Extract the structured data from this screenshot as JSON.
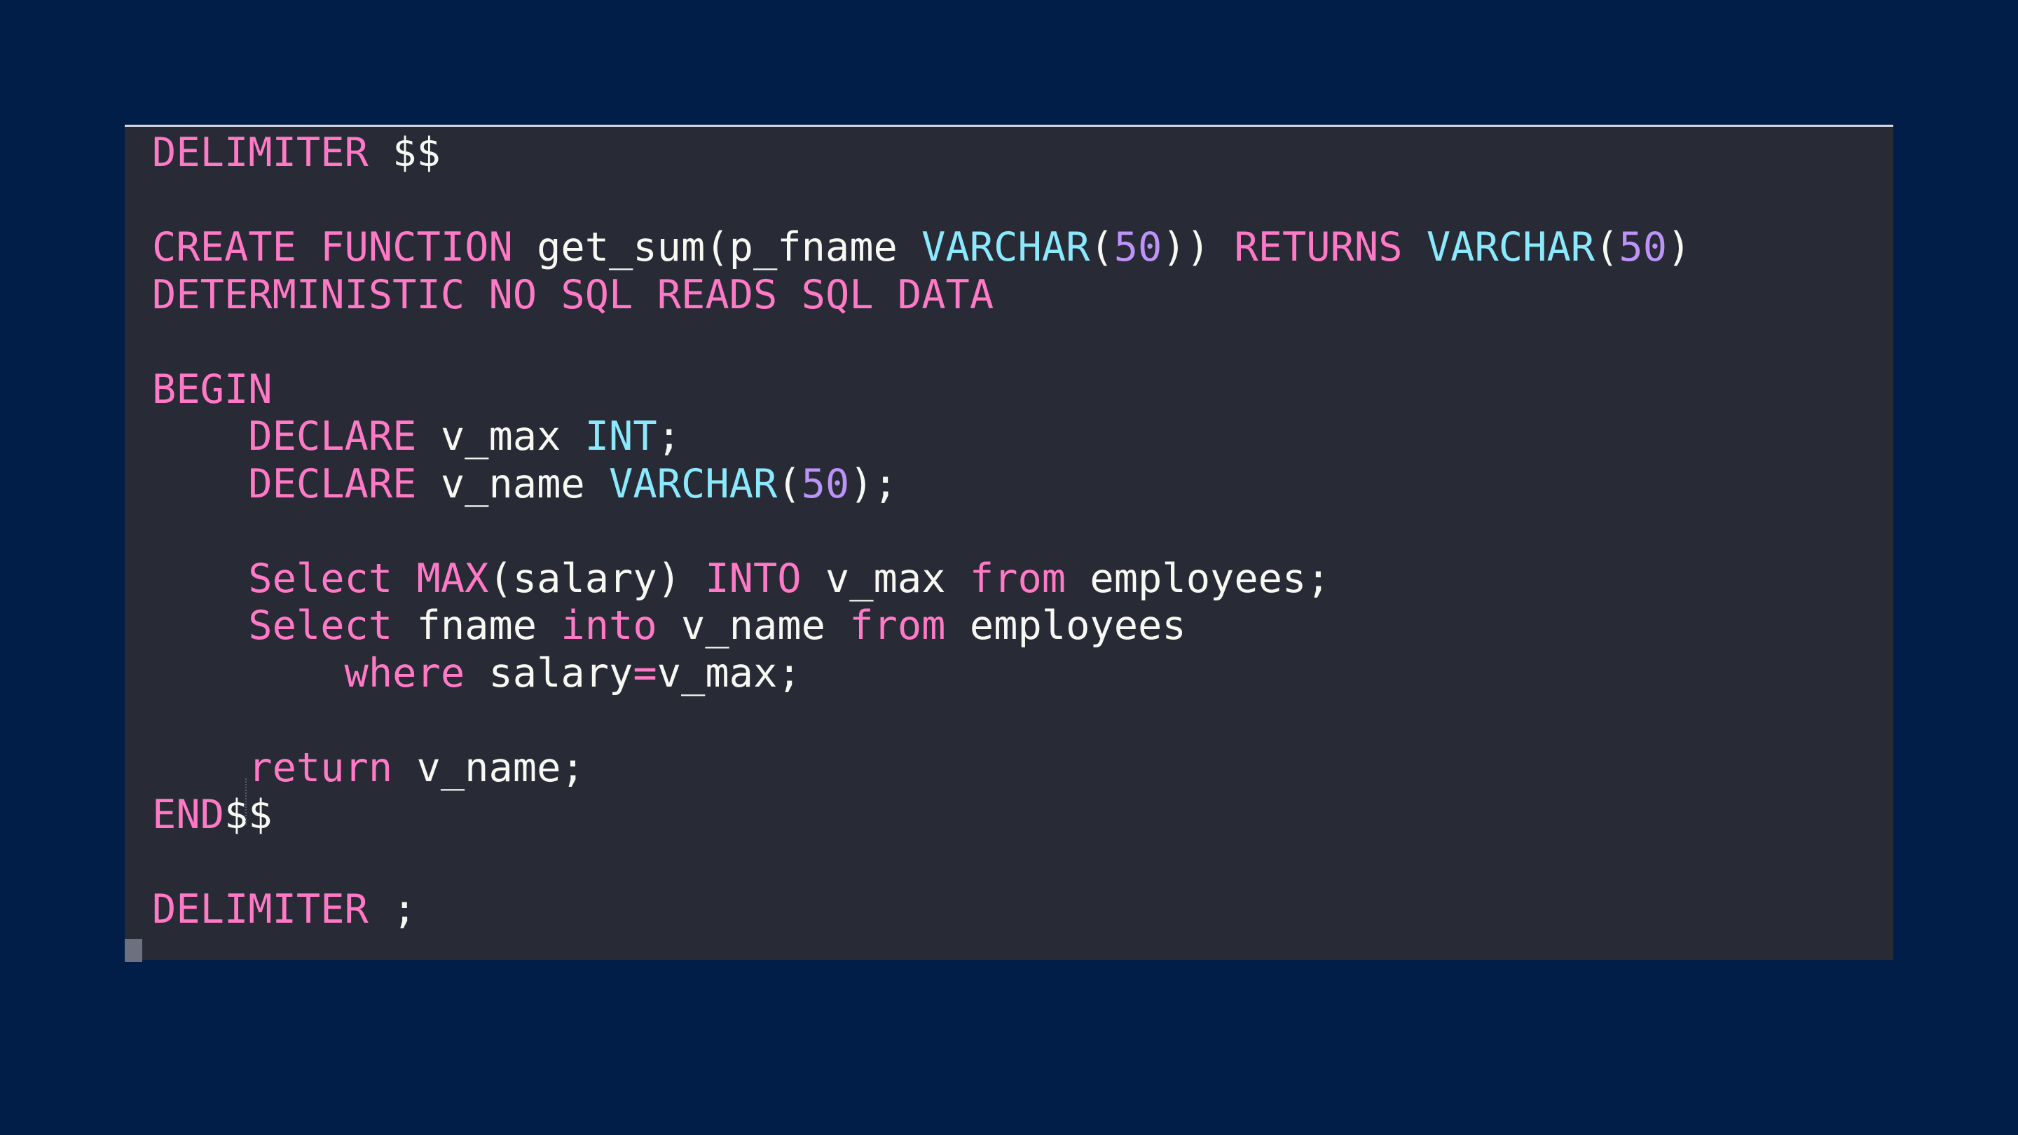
{
  "code_lines": [
    [
      {
        "t": "DELIMITER",
        "c": "kw"
      },
      {
        "t": " $$",
        "c": "tx"
      }
    ],
    [],
    [
      {
        "t": "CREATE",
        "c": "kw"
      },
      {
        "t": " ",
        "c": "tx"
      },
      {
        "t": "FUNCTION",
        "c": "kw"
      },
      {
        "t": " get_sum(p_fname ",
        "c": "tx"
      },
      {
        "t": "VARCHAR",
        "c": "ty"
      },
      {
        "t": "(",
        "c": "tx"
      },
      {
        "t": "50",
        "c": "nm"
      },
      {
        "t": ")) ",
        "c": "tx"
      },
      {
        "t": "RETURNS",
        "c": "kw"
      },
      {
        "t": " ",
        "c": "tx"
      },
      {
        "t": "VARCHAR",
        "c": "ty"
      },
      {
        "t": "(",
        "c": "tx"
      },
      {
        "t": "50",
        "c": "nm"
      },
      {
        "t": ")",
        "c": "tx"
      }
    ],
    [
      {
        "t": "DETERMINISTIC",
        "c": "kw"
      },
      {
        "t": " ",
        "c": "tx"
      },
      {
        "t": "NO",
        "c": "kw"
      },
      {
        "t": " ",
        "c": "tx"
      },
      {
        "t": "SQL",
        "c": "kw"
      },
      {
        "t": " ",
        "c": "tx"
      },
      {
        "t": "READS",
        "c": "kw"
      },
      {
        "t": " ",
        "c": "tx"
      },
      {
        "t": "SQL",
        "c": "kw"
      },
      {
        "t": " ",
        "c": "tx"
      },
      {
        "t": "DATA",
        "c": "kw"
      }
    ],
    [],
    [
      {
        "t": "BEGIN",
        "c": "kw"
      }
    ],
    [
      {
        "t": "    ",
        "c": "tx"
      },
      {
        "t": "DECLARE",
        "c": "kw"
      },
      {
        "t": " v_max ",
        "c": "tx"
      },
      {
        "t": "INT",
        "c": "ty"
      },
      {
        "t": ";",
        "c": "tx"
      }
    ],
    [
      {
        "t": "    ",
        "c": "tx"
      },
      {
        "t": "DECLARE",
        "c": "kw"
      },
      {
        "t": " v_name ",
        "c": "tx"
      },
      {
        "t": "VARCHAR",
        "c": "ty"
      },
      {
        "t": "(",
        "c": "tx"
      },
      {
        "t": "50",
        "c": "nm"
      },
      {
        "t": ");",
        "c": "tx"
      }
    ],
    [],
    [
      {
        "t": "    ",
        "c": "tx"
      },
      {
        "t": "Select",
        "c": "kw"
      },
      {
        "t": " ",
        "c": "tx"
      },
      {
        "t": "MAX",
        "c": "kw"
      },
      {
        "t": "(salary) ",
        "c": "tx"
      },
      {
        "t": "INTO",
        "c": "kw"
      },
      {
        "t": " v_max ",
        "c": "tx"
      },
      {
        "t": "from",
        "c": "kw"
      },
      {
        "t": " employees;",
        "c": "tx"
      }
    ],
    [
      {
        "t": "    ",
        "c": "tx"
      },
      {
        "t": "Select",
        "c": "kw"
      },
      {
        "t": " fname ",
        "c": "tx"
      },
      {
        "t": "into",
        "c": "kw"
      },
      {
        "t": " v_name ",
        "c": "tx"
      },
      {
        "t": "from",
        "c": "kw"
      },
      {
        "t": " employees",
        "c": "tx"
      }
    ],
    [
      {
        "t": "        ",
        "c": "tx"
      },
      {
        "t": "where",
        "c": "kw"
      },
      {
        "t": " salary",
        "c": "tx"
      },
      {
        "t": "=",
        "c": "kw"
      },
      {
        "t": "v_max;",
        "c": "tx"
      }
    ],
    [],
    [
      {
        "t": "    ",
        "c": "tx"
      },
      {
        "t": "return",
        "c": "kw"
      },
      {
        "t": " v_name;",
        "c": "tx"
      }
    ],
    [
      {
        "t": "END",
        "c": "kw"
      },
      {
        "t": "$$",
        "c": "tx"
      }
    ],
    [],
    [
      {
        "t": "DELIMITER",
        "c": "kw"
      },
      {
        "t": " ;",
        "c": "tx"
      }
    ]
  ],
  "colors": {
    "background": "#001e48",
    "editor_background": "#282a35",
    "keyword": "#ff79c6",
    "type": "#8be9fd",
    "number": "#bd93f9",
    "text": "#f8f8f2"
  }
}
